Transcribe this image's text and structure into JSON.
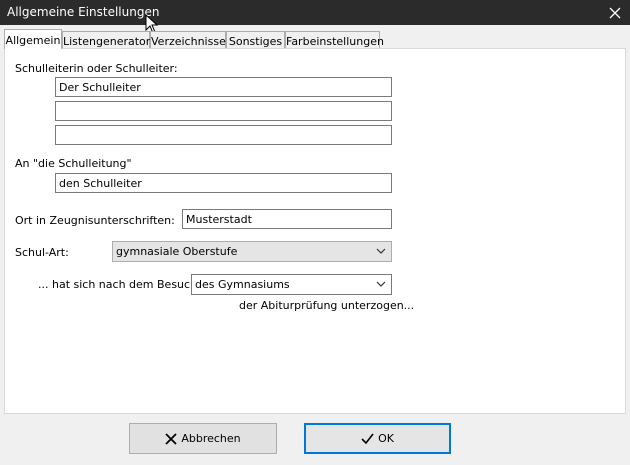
{
  "window": {
    "title": "Allgemeine Einstellungen"
  },
  "tabs": [
    {
      "label": "Allgemein",
      "active": true
    },
    {
      "label": "Listengenerator"
    },
    {
      "label": "Verzeichnisse"
    },
    {
      "label": "Sonstiges"
    },
    {
      "label": "Farbeinstellungen"
    }
  ],
  "form": {
    "principal_label": "Schulleiterin oder Schulleiter:",
    "principal_line1": "Der Schulleiter",
    "principal_line2": "",
    "principal_line3": "",
    "address_label": "An \"die Schulleitung\"",
    "address_value": "den Schulleiter",
    "place_label": "Ort in Zeugnisunterschriften:",
    "place_value": "Musterstadt",
    "school_type_label": "Schul-Art:",
    "school_type_value": "gymnasiale Oberstufe",
    "visit_label": "... hat sich nach dem Besuch",
    "visit_value": "des Gymnasiums",
    "suffix_text": "der Abiturprüfung  unterzogen..."
  },
  "buttons": {
    "cancel": "Abbrechen",
    "ok": "OK"
  },
  "colors": {
    "titlebar": "#2b2b2b",
    "focus_border": "#0078d7"
  }
}
